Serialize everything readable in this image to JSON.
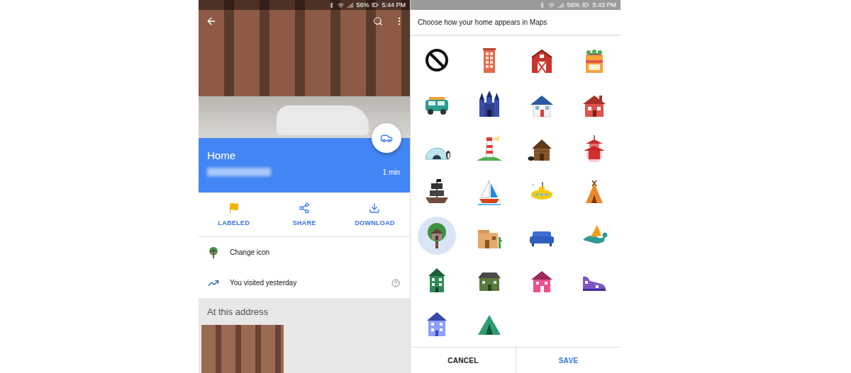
{
  "place_sheet": {
    "status_bar": {
      "battery": "56%",
      "time": "5:44 PM"
    },
    "title": "Home",
    "eta": "1 min",
    "actions": [
      {
        "label": "LABELED",
        "kind": "flag",
        "active": true
      },
      {
        "label": "SHARE",
        "kind": "share",
        "active": false
      },
      {
        "label": "DOWNLOAD",
        "kind": "download",
        "active": false
      }
    ],
    "rows": [
      {
        "label": "Change icon",
        "kind": "change-icon"
      },
      {
        "label": "You visited yesterday",
        "kind": "history"
      }
    ],
    "section_title": "At this address"
  },
  "icon_picker": {
    "status_bar": {
      "battery": "56%",
      "time": "5:43 PM"
    },
    "title": "Choose how your home appears in Maps",
    "icons": [
      {
        "selected": false
      },
      {
        "selected": false
      },
      {
        "selected": false
      },
      {
        "selected": false
      },
      {
        "selected": false
      },
      {
        "selected": false
      },
      {
        "selected": false
      },
      {
        "selected": false
      },
      {
        "selected": false
      },
      {
        "selected": false
      },
      {
        "selected": false
      },
      {
        "selected": false
      },
      {
        "selected": false
      },
      {
        "selected": false
      },
      {
        "selected": false
      },
      {
        "selected": false
      },
      {
        "selected": true
      },
      {
        "selected": false
      },
      {
        "selected": false
      },
      {
        "selected": false
      },
      {
        "selected": false
      },
      {
        "selected": false
      },
      {
        "selected": false
      },
      {
        "selected": false
      },
      {
        "selected": false
      },
      {
        "selected": false
      }
    ],
    "buttons": [
      {
        "label": "CANCEL",
        "kind": "cancel"
      },
      {
        "label": "SAVE",
        "kind": "save"
      }
    ]
  }
}
